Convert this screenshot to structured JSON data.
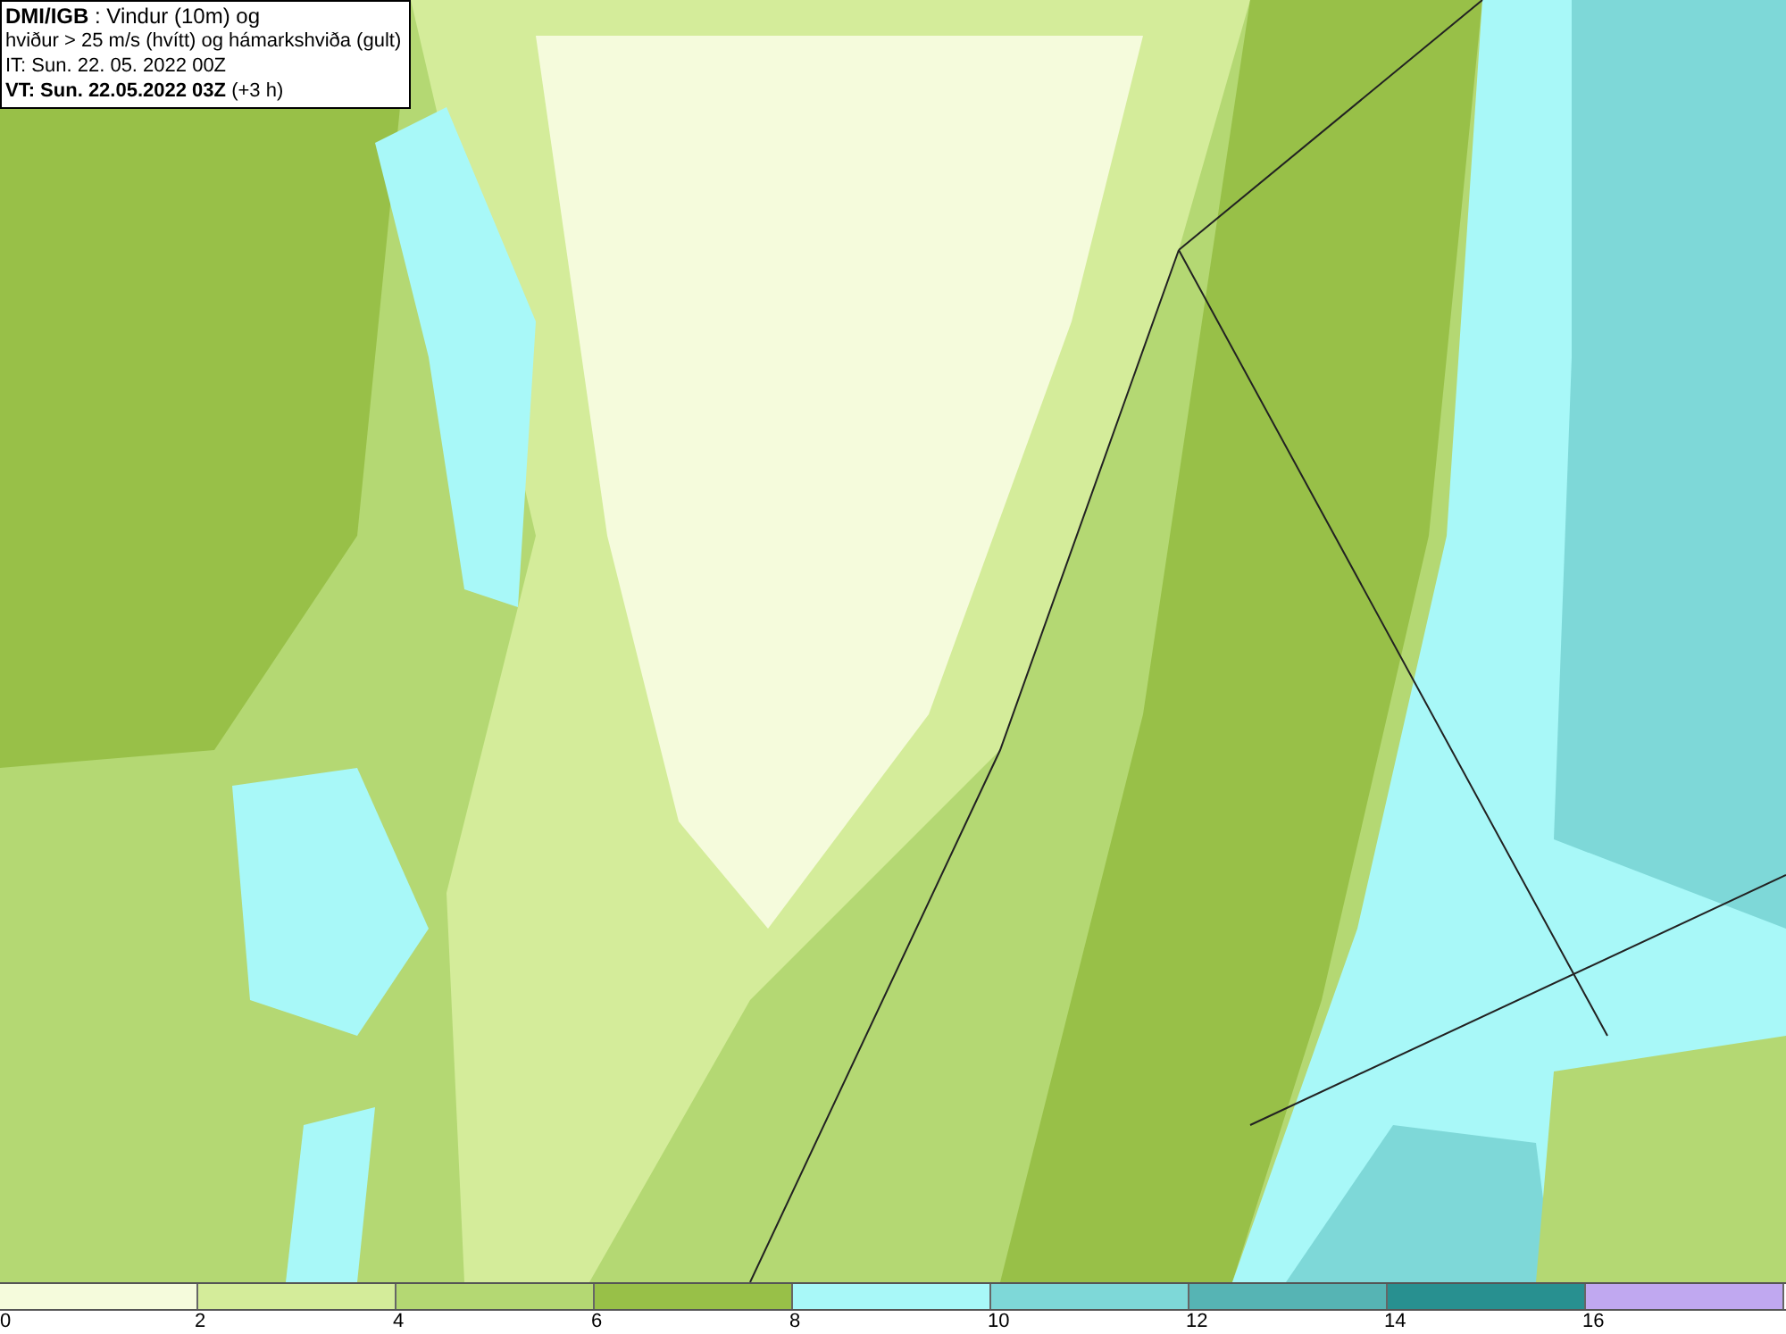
{
  "title_box": {
    "lines": [
      "**DMI/IGB** : Vindur (10m) og",
      "hviður > 25 m/s (hvítt) og hámarkshviða (gult)",
      "IT: Sun. 22. 05. 2022 00Z",
      "**VT: Sun. 22.05.2022 03Z** (+3 h)"
    ]
  },
  "legend": {
    "bins": [
      {
        "color": "#f5fbdc",
        "label": "0"
      },
      {
        "color": "#d4ec9a",
        "label": "2"
      },
      {
        "color": "#b4d873",
        "label": "4"
      },
      {
        "color": "#98c048",
        "label": "6"
      },
      {
        "color": "#a8f8f8",
        "label": "8"
      },
      {
        "color": "#7ed8d8",
        "label": "10"
      },
      {
        "color": "#56b4b4",
        "label": "12"
      },
      {
        "color": "#289090",
        "label": "14"
      },
      {
        "color": "#c0a8f0",
        "label": "16"
      }
    ]
  }
}
